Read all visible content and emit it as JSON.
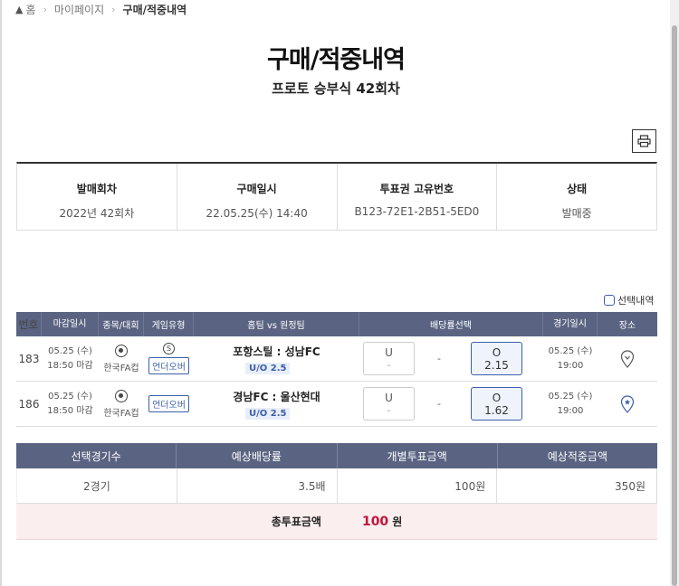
{
  "breadcrumb": {
    "home": "홈",
    "mypage": "마이페이지",
    "current": "구매/적중내역"
  },
  "page": {
    "title": "구매/적중내역",
    "subtitle": "프로토 승부식 42회차"
  },
  "info": {
    "headers": [
      "발매회차",
      "구매일시",
      "투표권 고유번호",
      "상태"
    ],
    "values": [
      "2022년 42회차",
      "22.05.25(수) 14:40",
      "B123-72E1-2B51-5ED0",
      "발매중"
    ]
  },
  "select_toggle": "선택내역",
  "games": {
    "headers": [
      "번호",
      "마감일시",
      "종목/대회",
      "게임유형",
      "홈팀 vs 원정팀",
      "배당률선택",
      "경기일시",
      "장소"
    ],
    "rows": [
      {
        "no": "183",
        "deadline_date": "05.25 (수)",
        "deadline_time": "18:50 마감",
        "league": "한국FA컵",
        "type_icon": "S",
        "type": "언더오버",
        "teams": "포항스틸 : 성남FC",
        "handicap": "U/O 2.5",
        "u_label": "U",
        "u_value": "-",
        "mid": "-",
        "o_label": "O",
        "o_value": "2.15",
        "date": "05.25 (수)",
        "time": "19:00"
      },
      {
        "no": "186",
        "deadline_date": "05.25 (수)",
        "deadline_time": "18:50 마감",
        "league": "한국FA컵",
        "type": "언더오버",
        "teams": "경남FC : 울산현대",
        "handicap": "U/O 2.5",
        "u_label": "U",
        "u_value": "-",
        "mid": "-",
        "o_label": "O",
        "o_value": "1.62",
        "date": "05.25 (수)",
        "time": "19:00"
      }
    ]
  },
  "summary": {
    "headers": [
      "선택경기수",
      "예상배당률",
      "개별투표금액",
      "예상적중금액"
    ],
    "values": [
      "2경기",
      "3.5배",
      "100원",
      "350원"
    ],
    "total_label": "총투표금액",
    "total_amount": "100",
    "total_unit": "원"
  },
  "colors": {
    "header_bg": "#5a6482",
    "accent": "#3c5fa8",
    "total_red": "#c0143c",
    "total_bg": "#fbeeee"
  }
}
